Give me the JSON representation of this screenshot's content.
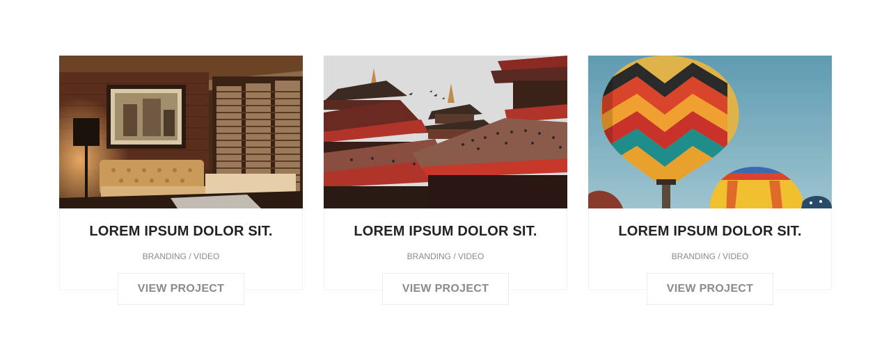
{
  "cards": [
    {
      "title": "LOREM IPSUM DOLOR SIT.",
      "meta": "BRANDING / VIDEO",
      "button_label": "VIEW PROJECT",
      "image_subject": "vintage lounge interior"
    },
    {
      "title": "LOREM IPSUM DOLOR SIT.",
      "meta": "BRANDING / VIDEO",
      "button_label": "VIEW PROJECT",
      "image_subject": "pagoda temple rooftops"
    },
    {
      "title": "LOREM IPSUM DOLOR SIT.",
      "meta": "BRANDING / VIDEO",
      "button_label": "VIEW PROJECT",
      "image_subject": "hot air balloons"
    }
  ]
}
